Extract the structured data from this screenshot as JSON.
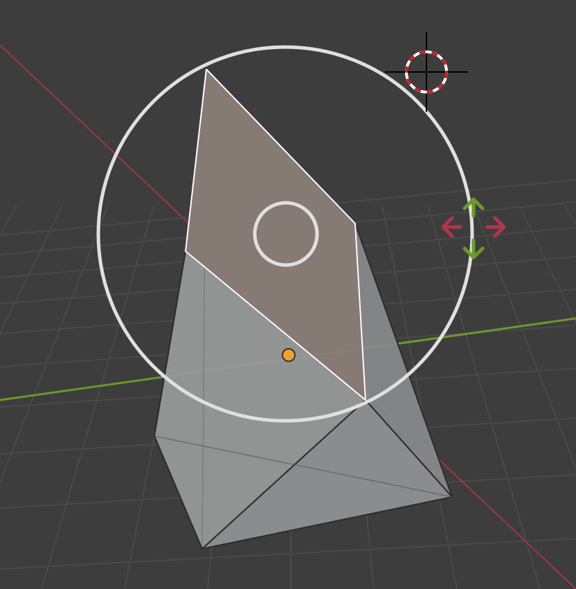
{
  "viewport": {
    "background_color": "#3d3d3d",
    "grid_color": "#4a4a4a",
    "x_axis_color": "#b0364a",
    "y_axis_color": "#6b9a2c"
  },
  "mesh": {
    "body_color": "#9a9b9b",
    "side_color": "#8a8b8c",
    "edge_color": "#2a2a2a",
    "selected_face_color": "#8a7d78",
    "selected_edge_color": "#ffffff",
    "origin_color": "#f0a030"
  },
  "tool_gizmo": {
    "ring_color": "#e0e0e0",
    "icons": {
      "move_up": "arrow-up-icon",
      "move_down": "arrow-down-icon",
      "move_left": "arrow-left-icon",
      "move_right": "arrow-right-icon"
    },
    "vertical_arrow_color": "#6b9a2c",
    "horizontal_arrow_color": "#b0364a"
  },
  "cursor_3d": {
    "icon": "3d-cursor-icon",
    "ring_color_a": "#ffffff",
    "ring_color_b": "#cc2020",
    "crosshair_color": "#000000"
  }
}
